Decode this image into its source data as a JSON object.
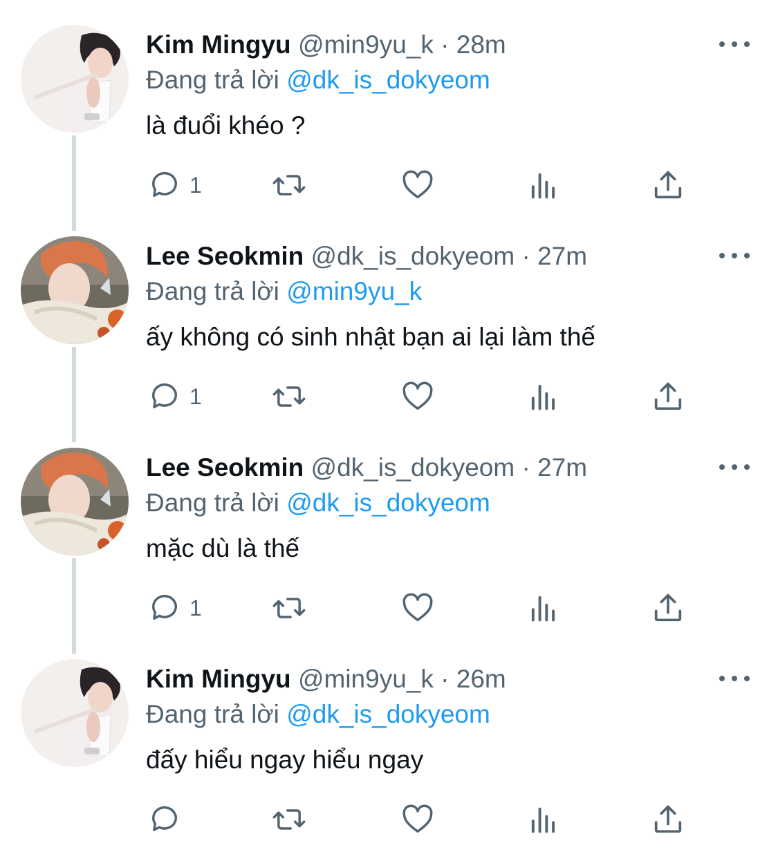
{
  "colors": {
    "accent": "#1d9bf0",
    "secondary_text": "#536471",
    "primary_text": "#0f1419",
    "thread_line": "#cfd9de"
  },
  "tweets": [
    {
      "name": "Kim Mingyu",
      "handle": "@min9yu_k",
      "separator": "·",
      "time": "28m",
      "reply_prefix": "Đang trả lời",
      "reply_to": "@dk_is_dokyeom",
      "text": "là đuổi khéo ?",
      "reply_count": "1",
      "avatar": "kim-mingyu-avatar"
    },
    {
      "name": "Lee Seokmin",
      "handle": "@dk_is_dokyeom",
      "separator": "·",
      "time": "27m",
      "reply_prefix": "Đang trả lời",
      "reply_to": "@min9yu_k",
      "text": "ấy không có sinh nhật bạn ai lại làm thế",
      "reply_count": "1",
      "avatar": "lee-seokmin-avatar"
    },
    {
      "name": "Lee Seokmin",
      "handle": "@dk_is_dokyeom",
      "separator": "·",
      "time": "27m",
      "reply_prefix": "Đang trả lời",
      "reply_to": "@dk_is_dokyeom",
      "text": "mặc dù là thế",
      "reply_count": "1",
      "avatar": "lee-seokmin-avatar"
    },
    {
      "name": "Kim Mingyu",
      "handle": "@min9yu_k",
      "separator": "·",
      "time": "26m",
      "reply_prefix": "Đang trả lời",
      "reply_to": "@dk_is_dokyeom",
      "text": "đấy hiểu ngay hiểu ngay",
      "reply_count": "",
      "avatar": "kim-mingyu-avatar"
    }
  ],
  "icons": {
    "reply": "reply-icon",
    "retweet": "retweet-icon",
    "like": "heart-icon",
    "views": "analytics-icon",
    "share": "share-icon",
    "more": "more-icon"
  }
}
